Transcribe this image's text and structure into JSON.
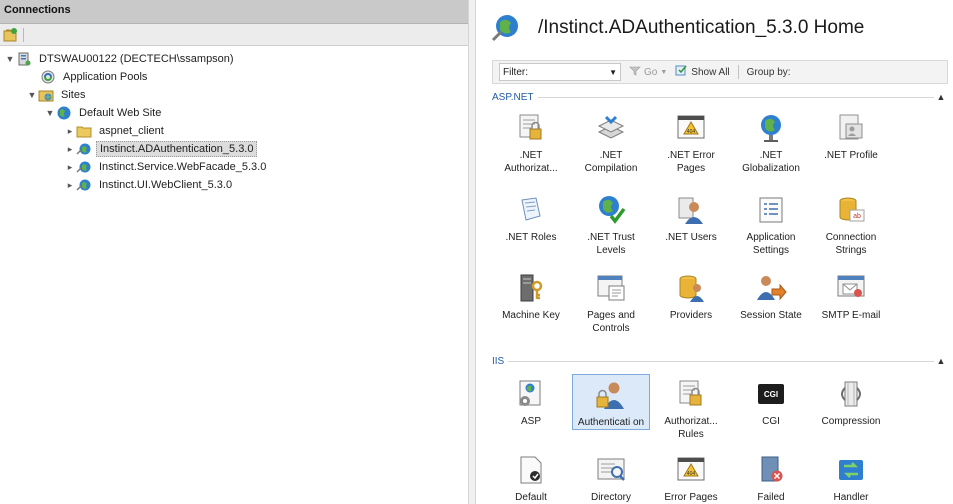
{
  "connections": {
    "title": "Connections",
    "tree": [
      {
        "label": "DTSWAU00122 (DECTECH\\ssampson)",
        "icon": "server-icon",
        "expander": "chevron-down"
      },
      {
        "label": "Application Pools",
        "icon": "app-pools-icon",
        "expander": ""
      },
      {
        "label": "Sites",
        "icon": "sites-folder-icon",
        "expander": "chevron-down"
      },
      {
        "label": "Default Web Site",
        "icon": "globe-icon",
        "expander": "chevron-down"
      },
      {
        "label": "aspnet_client",
        "icon": "folder-icon",
        "expander": "chevron-right"
      },
      {
        "label": "Instinct.ADAuthentication_5.3.0",
        "icon": "web-app-icon",
        "expander": "chevron-right"
      },
      {
        "label": "Instinct.Service.WebFacade_5.3.0",
        "icon": "web-app-icon",
        "expander": "chevron-right"
      },
      {
        "label": "Instinct.UI.WebClient_5.3.0",
        "icon": "web-app-icon",
        "expander": "chevron-right"
      }
    ]
  },
  "home": {
    "title": "/Instinct.ADAuthentication_5.3.0 Home"
  },
  "filter_bar": {
    "filter_label": "Filter:",
    "go_label": "Go",
    "show_all_label": "Show All",
    "group_by_label": "Group by:"
  },
  "sections": [
    {
      "label": "ASP.NET",
      "features": [
        {
          "label": ".NET Authorizat...",
          "icon": "net-authorization-icon"
        },
        {
          "label": ".NET Compilation",
          "icon": "net-compilation-icon"
        },
        {
          "label": ".NET Error Pages",
          "icon": "net-error-pages-icon"
        },
        {
          "label": ".NET Globalization",
          "icon": "net-globalization-icon"
        },
        {
          "label": ".NET Profile",
          "icon": "net-profile-icon"
        },
        {
          "label": ".NET Roles",
          "icon": "net-roles-icon"
        },
        {
          "label": ".NET Trust Levels",
          "icon": "net-trust-levels-icon"
        },
        {
          "label": ".NET Users",
          "icon": "net-users-icon"
        },
        {
          "label": "Application Settings",
          "icon": "application-settings-icon"
        },
        {
          "label": "Connection Strings",
          "icon": "connection-strings-icon"
        },
        {
          "label": "Machine Key",
          "icon": "machine-key-icon"
        },
        {
          "label": "Pages and Controls",
          "icon": "pages-controls-icon"
        },
        {
          "label": "Providers",
          "icon": "providers-icon"
        },
        {
          "label": "Session State",
          "icon": "session-state-icon"
        },
        {
          "label": "SMTP E-mail",
          "icon": "smtp-email-icon"
        }
      ]
    },
    {
      "label": "IIS",
      "features": [
        {
          "label": "ASP",
          "icon": "asp-icon"
        },
        {
          "label": "Authenticati on",
          "icon": "authentication-icon",
          "selected": true
        },
        {
          "label": "Authorizat... Rules",
          "icon": "authorization-rules-icon"
        },
        {
          "label": "CGI",
          "icon": "cgi-icon"
        },
        {
          "label": "Compression",
          "icon": "compression-icon"
        },
        {
          "label": "Default",
          "icon": "default-document-icon"
        },
        {
          "label": "Directory",
          "icon": "directory-browsing-icon"
        },
        {
          "label": "Error Pages",
          "icon": "error-pages-icon"
        },
        {
          "label": "Failed",
          "icon": "failed-request-icon"
        },
        {
          "label": "Handler",
          "icon": "handler-mappings-icon"
        }
      ]
    }
  ]
}
